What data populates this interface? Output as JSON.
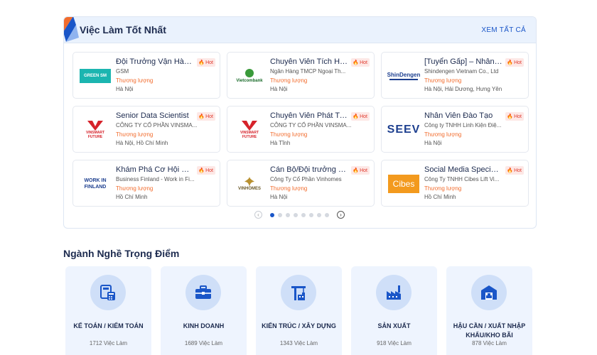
{
  "best_jobs": {
    "title": "Việc Làm Tốt Nhất",
    "view_all": "XEM TẤT CẢ",
    "hot_label": "Hot",
    "jobs": [
      {
        "title": "Đội Trưởng Vận Hành...",
        "company": "GSM",
        "salary": "Thương lượng",
        "location": "Hà Nội",
        "logo_text": "GREEN SM",
        "logo": "gsm-logo"
      },
      {
        "title": "Chuyên Viên Tích Hợ...",
        "company": "Ngân Hàng TMCP Ngoại Th...",
        "salary": "Thương lượng",
        "location": "Hà Nội",
        "logo_text": "Vietcombank",
        "logo": "vietcombank-logo"
      },
      {
        "title": "[Tuyển Gấp] – Nhân V...",
        "company": "Shindengen Vietnam Co., Ltd",
        "salary": "Thương lượng",
        "location": "Hà Nội, Hải Dương, Hưng Yên",
        "logo_text": "ShinDengen",
        "logo": "shindengen-logo"
      },
      {
        "title": "Senior Data Scientist",
        "company": "CÔNG TY CỔ PHẦN VINSMA...",
        "salary": "Thương lượng",
        "location": "Hà Nội, Hồ Chí Minh",
        "logo_text": "VINSMART FUTURE",
        "logo": "vinsmart-logo"
      },
      {
        "title": "Chuyên Viên Phát Tri...",
        "company": "CÔNG TY CỔ PHẦN VINSMA...",
        "salary": "Thương lượng",
        "location": "Hà Tĩnh",
        "logo_text": "VINSMART FUTURE",
        "logo": "vinsmart-logo"
      },
      {
        "title": "Nhân Viên Đào Tạo",
        "company": "Công ty TNHH Linh Kiện Điệ...",
        "salary": "Thương lượng",
        "location": "Hà Nội",
        "logo_text": "SEEV",
        "logo": "seev-logo"
      },
      {
        "title": "Khám Phá Cơ Hội Phá...",
        "company": "Business Finland - Work in Fi...",
        "salary": "Thương lượng",
        "location": "Hồ Chí Minh",
        "logo_text": "WORK IN FINLAND",
        "logo": "work-in-finland-logo"
      },
      {
        "title": "Cán Bộ/Đội trưởng Gi...",
        "company": "Công Ty Cổ Phần Vinhomes",
        "salary": "Thương lượng",
        "location": "Hà Nội",
        "logo_text": "VINHOMES",
        "logo": "vinhomes-logo"
      },
      {
        "title": "Social Media Specialist",
        "company": "Công Ty TNHH Cibes Lift Vi...",
        "salary": "Thương lượng",
        "location": "Hồ Chí Minh",
        "logo_text": "Cibes",
        "logo": "cibes-logo"
      }
    ],
    "pager": {
      "prev_icon": "chevron-left-icon",
      "next_icon": "chevron-right-icon",
      "page_count": 8,
      "active_page": 1
    }
  },
  "industries": {
    "title": "Ngành Nghề Trọng Điểm",
    "items": [
      {
        "name": "KẾ TOÁN / KIỂM TOÁN",
        "count": "1712 Việc Làm",
        "icon": "accounting-icon"
      },
      {
        "name": "KINH DOANH",
        "count": "1689 Việc Làm",
        "icon": "briefcase-icon"
      },
      {
        "name": "KIẾN TRÚC / XÂY DỰNG",
        "count": "1343 Việc Làm",
        "icon": "crane-icon"
      },
      {
        "name": "SẢN XUẤT",
        "count": "918 Việc Làm",
        "icon": "factory-icon"
      },
      {
        "name": "HẬU CẦN / XUẤT NHẬP KHẨU/KHO BÃI",
        "count": "878 Việc Làm",
        "icon": "warehouse-icon"
      }
    ]
  },
  "colors": {
    "accent": "#1a56c8",
    "salary": "#f26c2d",
    "hot": "#e03a2e",
    "header_bg": "#eaf2fd",
    "industry_bg": "#eef4fe"
  }
}
